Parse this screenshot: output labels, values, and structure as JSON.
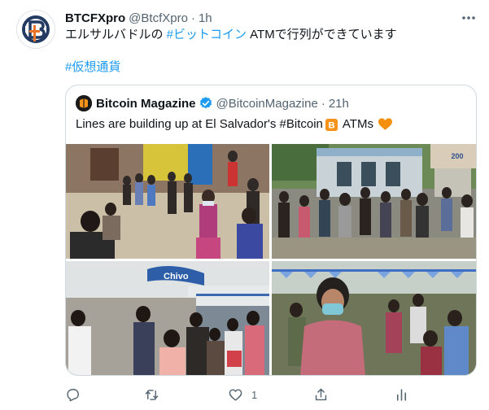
{
  "tweet": {
    "author_name": "BTCFXpro",
    "author_handle": "@BtcfXpro",
    "separator": "·",
    "time": "1h",
    "text_before": "エルサルバドルの ",
    "text_link": "#ビットコイン",
    "text_after": " ATMで行列ができています",
    "hashtag": "#仮想通貨"
  },
  "quote": {
    "author_name": "Bitcoin Magazine",
    "author_handle": "@BitcoinMagazine",
    "separator": "·",
    "time": "21h",
    "text_main": "Lines are building up at El Salvador's #Bitcoin",
    "text_end": "ATMs",
    "photos": [
      "photo-1",
      "photo-2",
      "photo-3",
      "photo-4"
    ]
  },
  "actions": {
    "reply_count": "",
    "retweet_count": "",
    "like_count": "1",
    "share_count": ""
  },
  "icons": {
    "more": "more-icon",
    "verified": "verified-badge-icon",
    "reply": "reply-icon",
    "retweet": "retweet-icon",
    "like": "heart-icon",
    "share": "share-icon",
    "analytics": "analytics-icon"
  },
  "colors": {
    "accent": "#1d9bf0",
    "text": "#0f1419",
    "muted": "#536471",
    "border": "#cfd9de",
    "bitcoin": "#f7931a",
    "heart_emoji": "#f4900c"
  }
}
